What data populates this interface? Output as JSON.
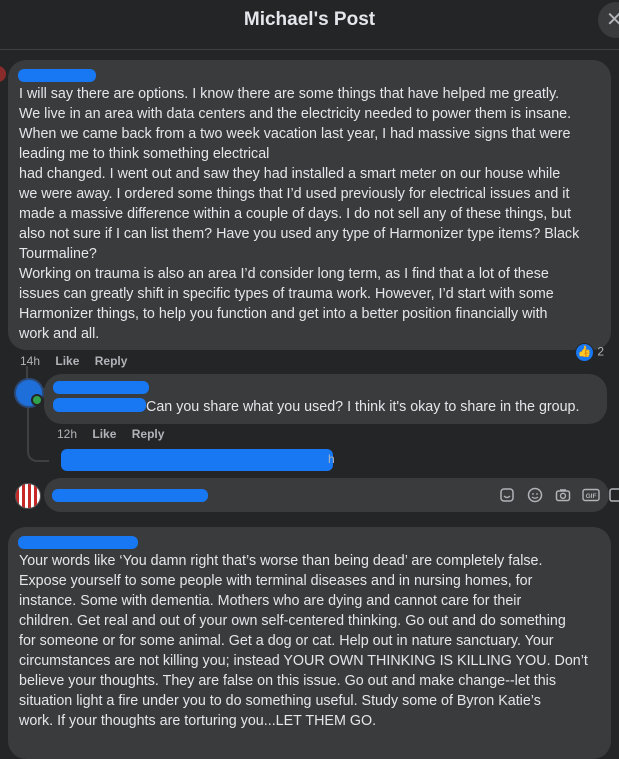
{
  "header": {
    "title": "Michael's Post",
    "close_icon": "close-icon"
  },
  "comment1": {
    "text": "I will say there are options. I know there are some things that have helped me greatly.\nWe live in an area with data centers and the electricity needed to power them is insane.\nWhen we came back from a two week vacation last year, I had massive signs that were\nleading me to think something electrical\nhad changed. I went out and saw they had installed a smart meter on our house while\nwe were away. I ordered some things that I’d used previously for electrical issues and it\nmade a massive difference within a couple of days. I do not sell any of these things, but\nalso not sure if I can list them? Have you used any type of Harmonizer type items? Black\nTourmaline?\nWorking on trauma is also an area I’d consider long term, as I find that a lot of these\nissues can greatly shift in specific types of trauma work. However, I’d start with some\nHarmonizer things, to help you function and get into a better position financially with\nwork and all.",
    "time": "14h",
    "like_label": "Like",
    "reply_label": "Reply",
    "reaction_count": "2"
  },
  "reply1": {
    "text": "Can you share what you used? I think it's okay to share in the group.",
    "time": "12h",
    "like_label": "Like",
    "reply_label": "Reply",
    "thread_suffix": "h"
  },
  "reply_box": {
    "icons": [
      "sticker-icon",
      "emoji-icon",
      "camera-icon",
      "gif-icon",
      "stamp-icon"
    ],
    "gif_label": "GIF"
  },
  "comment2": {
    "text": "Your words like ‘You damn right that’s worse than being dead’ are completely false.\nExpose yourself to some people with terminal diseases and in nursing homes, for\ninstance. Some with dementia. Mothers who are dying and cannot care for their\nchildren. Get real and out of your own self-centered thinking. Go out and do something\nfor someone or for some animal. Get a dog or cat. Help out in nature sanctuary. Your\ncircumstances are not killing you; instead YOUR OWN THINKING IS KILLING YOU. Don’t\nbelieve your thoughts. They are false on this issue. Go out and make change--let this\nsituation light a fire under you to do something useful. Study some of Byron Katie’s\nwork. If your thoughts are torturing you...LET THEM GO."
  }
}
